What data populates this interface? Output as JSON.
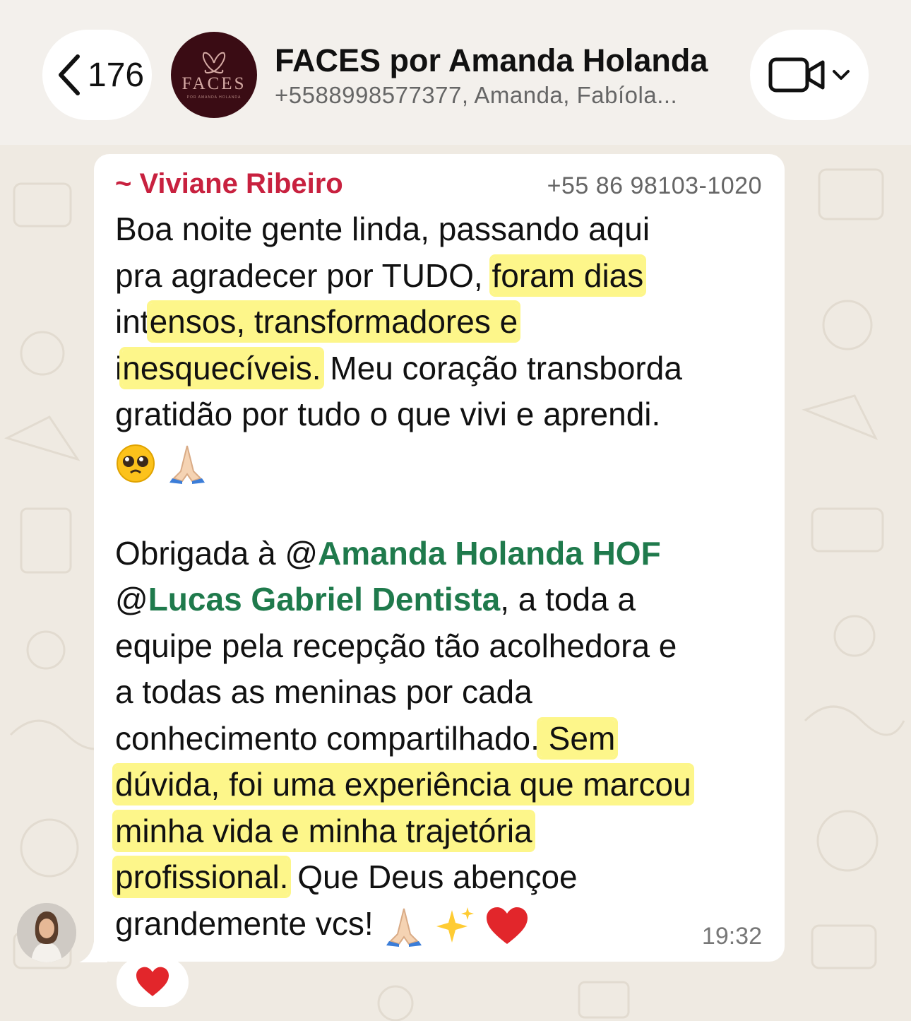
{
  "header": {
    "back_count": "176",
    "group_name": "FACES por Amanda Holanda",
    "group_subtitle": "+5588998577377, Amanda, Fabíola...",
    "logo_text": "FACES",
    "logo_subtext": "POR AMANDA HOLANDA"
  },
  "message": {
    "sender": "~ Viviane Ribeiro",
    "sender_phone": "+55 86 98103-1020",
    "lines": [
      [
        "Boa noite gente linda, passando aqui"
      ],
      [
        "pra agradecer por TUDO, ",
        "foram dias"
      ],
      [
        "int",
        "ensos, transformadores e"
      ],
      [
        "i",
        "nesquecíveis.",
        " Meu coração transborda"
      ],
      [
        "gratidão por tudo o que vivi e aprendi."
      ],
      [
        "Obrigada à @",
        "Amanda Holanda HOF"
      ],
      [
        "@",
        "Lucas Gabriel Dentista",
        ", a toda a"
      ],
      [
        "equipe pela recepção tão acolhedora e"
      ],
      [
        "a todas as meninas por cada"
      ],
      [
        "conhecimento compartilhado.",
        " Sem"
      ],
      [
        "dúvida, foi uma experiência que marcou"
      ],
      [
        "minha vida e minha trajetória"
      ],
      [
        "profissional.",
        "  Que Deus abençoe"
      ],
      [
        "grandemente vcs!"
      ]
    ],
    "emojis": [
      "pleading-face",
      "folded-hands",
      "folded-hands",
      "sparkles",
      "red-heart"
    ],
    "time": "19:32",
    "reaction": "red-heart"
  },
  "colors": {
    "background": "#efeae2",
    "sender_name": "#c8213f",
    "mention": "#1f7a4c",
    "highlight": "#fdf68a"
  }
}
